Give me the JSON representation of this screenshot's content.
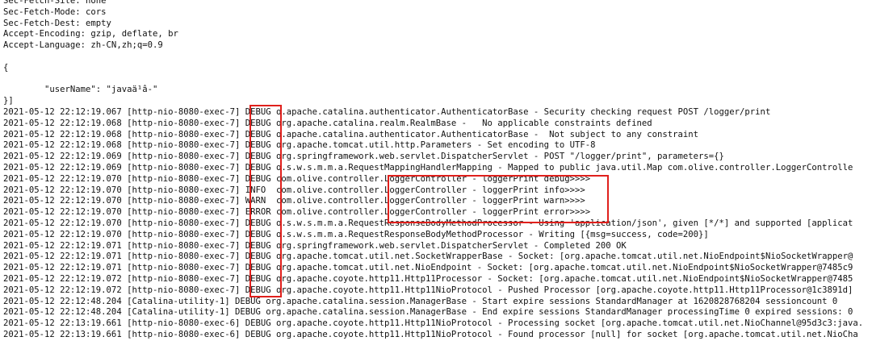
{
  "log_lines": [
    "Sec-Fetch-Site: none",
    "Sec-Fetch-Mode: cors",
    "Sec-Fetch-Dest: empty",
    "Accept-Encoding: gzip, deflate, br",
    "Accept-Language: zh-CN,zh;q=0.9",
    "",
    "{",
    "",
    "        \"userName\": \"javaä¹â-\"",
    "}]",
    "2021-05-12 22:12:19.067 [http-nio-8080-exec-7] DEBUG o.apache.catalina.authenticator.AuthenticatorBase - Security checking request POST /logger/print",
    "2021-05-12 22:12:19.068 [http-nio-8080-exec-7] DEBUG org.apache.catalina.realm.RealmBase -   No applicable constraints defined",
    "2021-05-12 22:12:19.068 [http-nio-8080-exec-7] DEBUG o.apache.catalina.authenticator.AuthenticatorBase -  Not subject to any constraint",
    "2021-05-12 22:12:19.068 [http-nio-8080-exec-7] DEBUG org.apache.tomcat.util.http.Parameters - Set encoding to UTF-8",
    "2021-05-12 22:12:19.069 [http-nio-8080-exec-7] DEBUG org.springframework.web.servlet.DispatcherServlet - POST \"/logger/print\", parameters={}",
    "2021-05-12 22:12:19.069 [http-nio-8080-exec-7] DEBUG o.s.w.s.m.m.a.RequestMappingHandlerMapping - Mapped to public java.util.Map com.olive.controller.LoggerControlle",
    "2021-05-12 22:12:19.070 [http-nio-8080-exec-7] DEBUG com.olive.controller.LoggerController - loggerPrint debug>>>>",
    "2021-05-12 22:12:19.070 [http-nio-8080-exec-7] INFO  com.olive.controller.LoggerController - loggerPrint info>>>>",
    "2021-05-12 22:12:19.070 [http-nio-8080-exec-7] WARN  com.olive.controller.LoggerController - loggerPrint warn>>>>",
    "2021-05-12 22:12:19.070 [http-nio-8080-exec-7] ERROR com.olive.controller.LoggerController - loggerPrint error>>>>",
    "2021-05-12 22:12:19.070 [http-nio-8080-exec-7] DEBUG o.s.w.s.m.m.a.RequestResponseBodyMethodProcessor - Using 'application/json', given [*/*] and supported [applicat",
    "2021-05-12 22:12:19.070 [http-nio-8080-exec-7] DEBUG o.s.w.s.m.m.a.RequestResponseBodyMethodProcessor - Writing [{msg=success, code=200}]",
    "2021-05-12 22:12:19.071 [http-nio-8080-exec-7] DEBUG org.springframework.web.servlet.DispatcherServlet - Completed 200 OK",
    "2021-05-12 22:12:19.071 [http-nio-8080-exec-7] DEBUG org.apache.tomcat.util.net.SocketWrapperBase - Socket: [org.apache.tomcat.util.net.NioEndpoint$NioSocketWrapper@",
    "2021-05-12 22:12:19.071 [http-nio-8080-exec-7] DEBUG org.apache.tomcat.util.net.NioEndpoint - Socket: [org.apache.tomcat.util.net.NioEndpoint$NioSocketWrapper@7485c9",
    "2021-05-12 22:12:19.072 [http-nio-8080-exec-7] DEBUG org.apache.coyote.http11.Http11Processor - Socket: [org.apache.tomcat.util.net.NioEndpoint$NioSocketWrapper@7485",
    "2021-05-12 22:12:19.072 [http-nio-8080-exec-7] DEBUG org.apache.coyote.http11.Http11NioProtocol - Pushed Processor [org.apache.coyote.http11.Http11Processor@1c3891d]",
    "2021-05-12 22:12:48.204 [Catalina-utility-1] DEBUG org.apache.catalina.session.ManagerBase - Start expire sessions StandardManager at 1620828768204 sessioncount 0",
    "2021-05-12 22:12:48.204 [Catalina-utility-1] DEBUG org.apache.catalina.session.ManagerBase - End expire sessions StandardManager processingTime 0 expired sessions: 0",
    "2021-05-12 22:13:19.661 [http-nio-8080-exec-6] DEBUG org.apache.coyote.http11.Http11NioProtocol - Processing socket [org.apache.tomcat.util.net.NioChannel@95d3c3:java.",
    "2021-05-12 22:13:19.661 [http-nio-8080-exec-6] DEBUG org.apache.coyote.http11.Http11NioProtocol - Found processor [null] for socket [org.apache.tomcat.util.net.NioCha"
  ],
  "colors": {
    "text": "#111111",
    "background": "#ffffff",
    "highlight_box": "#e0201c"
  }
}
